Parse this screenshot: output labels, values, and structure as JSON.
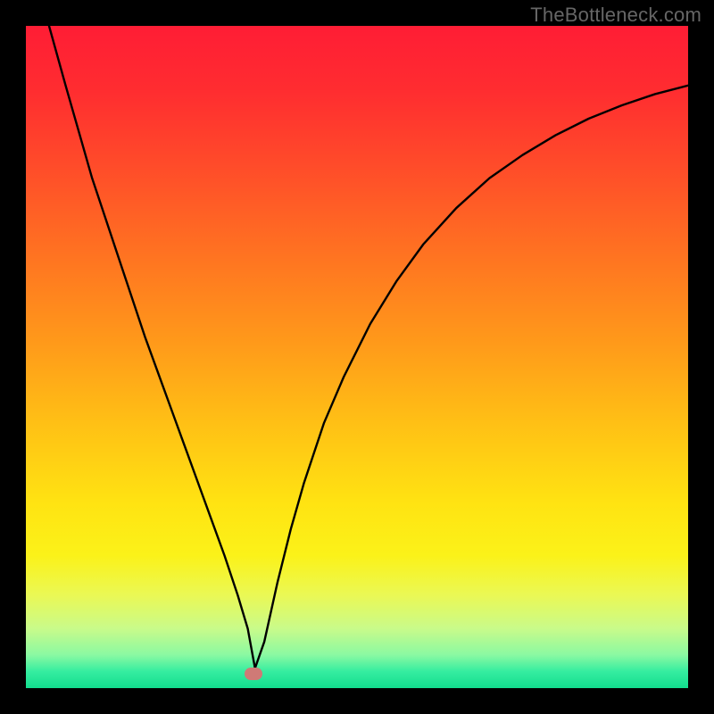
{
  "watermark": "TheBottleneck.com",
  "colors": {
    "frame": "#000000",
    "gradient_stops": [
      {
        "offset": 0.0,
        "color": "#ff1d35"
      },
      {
        "offset": 0.1,
        "color": "#ff2d30"
      },
      {
        "offset": 0.22,
        "color": "#ff4e29"
      },
      {
        "offset": 0.35,
        "color": "#ff7421"
      },
      {
        "offset": 0.48,
        "color": "#ff9a1a"
      },
      {
        "offset": 0.6,
        "color": "#ffc015"
      },
      {
        "offset": 0.72,
        "color": "#ffe312"
      },
      {
        "offset": 0.8,
        "color": "#fbf219"
      },
      {
        "offset": 0.86,
        "color": "#eaf855"
      },
      {
        "offset": 0.91,
        "color": "#c9fb8a"
      },
      {
        "offset": 0.95,
        "color": "#8af9a2"
      },
      {
        "offset": 0.975,
        "color": "#35eda0"
      },
      {
        "offset": 1.0,
        "color": "#12dd8e"
      }
    ],
    "curve": "#000000",
    "marker": "#cf7a76"
  },
  "chart_data": {
    "type": "line",
    "title": "",
    "xlabel": "",
    "ylabel": "",
    "xlim": [
      0,
      100
    ],
    "ylim": [
      0,
      100
    ],
    "x": [
      3.5,
      6,
      8,
      10,
      12,
      14,
      16,
      18,
      20,
      22,
      24,
      26,
      28,
      30,
      32,
      33.5,
      34.6,
      36,
      38,
      40,
      42,
      45,
      48,
      52,
      56,
      60,
      65,
      70,
      75,
      80,
      85,
      90,
      95,
      100
    ],
    "y": [
      100,
      91,
      84,
      77,
      71,
      65,
      59,
      53,
      47.5,
      42,
      36.5,
      31,
      25.5,
      20,
      14,
      9,
      3,
      7,
      16,
      24,
      31,
      40,
      47,
      55,
      61.5,
      67,
      72.5,
      77,
      80.5,
      83.5,
      86,
      88,
      89.7,
      91
    ],
    "marker": {
      "x": 34.3,
      "y": 2.2
    },
    "legend": null,
    "grid": false
  },
  "icons": {}
}
